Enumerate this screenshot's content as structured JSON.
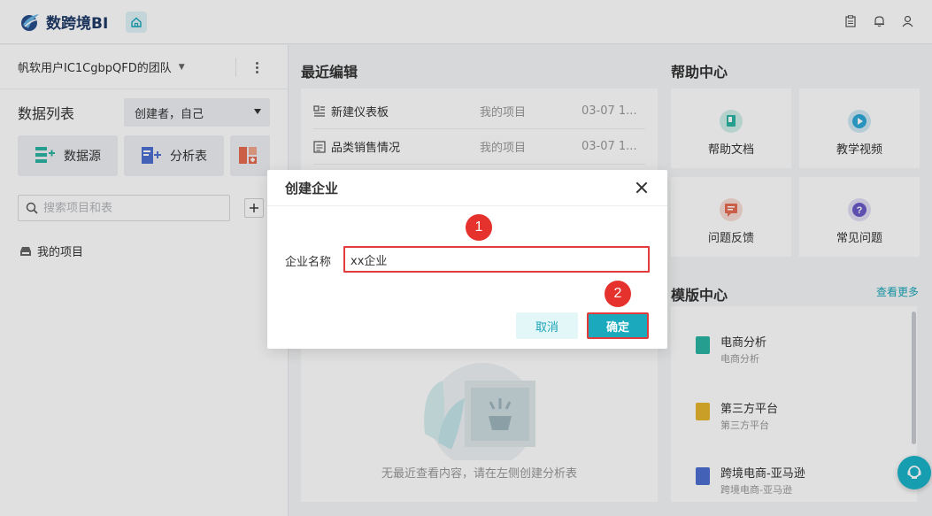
{
  "app": {
    "brand": "数跨境BI"
  },
  "team": {
    "name": "帆软用户IC1CgbpQFD的团队"
  },
  "datalist": {
    "title": "数据列表",
    "creator_filter": "创建者，自己",
    "buttons": [
      {
        "label": "数据源",
        "icon": "datasource-add-icon"
      },
      {
        "label": "分析表",
        "icon": "analysis-add-icon"
      }
    ],
    "search_placeholder": "搜索项目和表",
    "my_project": "我的项目"
  },
  "recent": {
    "title": "最近编辑",
    "rows": [
      {
        "name": "新建仪表板",
        "location": "我的项目",
        "time": "03-07 1..."
      },
      {
        "name": "品类销售情况",
        "location": "我的项目",
        "time": "03-07 1..."
      }
    ],
    "empty_text": "无最近查看内容，请在左侧创建分析表"
  },
  "help": {
    "title": "帮助中心",
    "items": [
      {
        "label": "帮助文档",
        "icon": "help-doc-icon",
        "color": "#2bb3a3"
      },
      {
        "label": "教学视频",
        "icon": "video-icon",
        "color": "#2ea8d6"
      },
      {
        "label": "问题反馈",
        "icon": "feedback-icon",
        "color": "#e86c50"
      },
      {
        "label": "常见问题",
        "icon": "faq-icon",
        "color": "#6a5bc9"
      }
    ]
  },
  "templates": {
    "title": "模版中心",
    "more": "查看更多",
    "items": [
      {
        "name": "电商分析",
        "sub": "电商分析",
        "color": "#2bb3a3"
      },
      {
        "name": "第三方平台",
        "sub": "第三方平台",
        "color": "#e6b52e"
      },
      {
        "name": "跨境电商-亚马逊",
        "sub": "跨境电商-亚马逊",
        "color": "#4d6fd1"
      }
    ]
  },
  "dialog": {
    "title": "创建企业",
    "field_label": "企业名称",
    "field_value": "xx企业",
    "cancel": "取消",
    "ok": "确定"
  },
  "annotations": {
    "step1": "1",
    "step2": "2"
  },
  "colors": {
    "accent": "#1aa9bd",
    "highlight": "#e23b3b",
    "brand": "#1f3b67"
  }
}
